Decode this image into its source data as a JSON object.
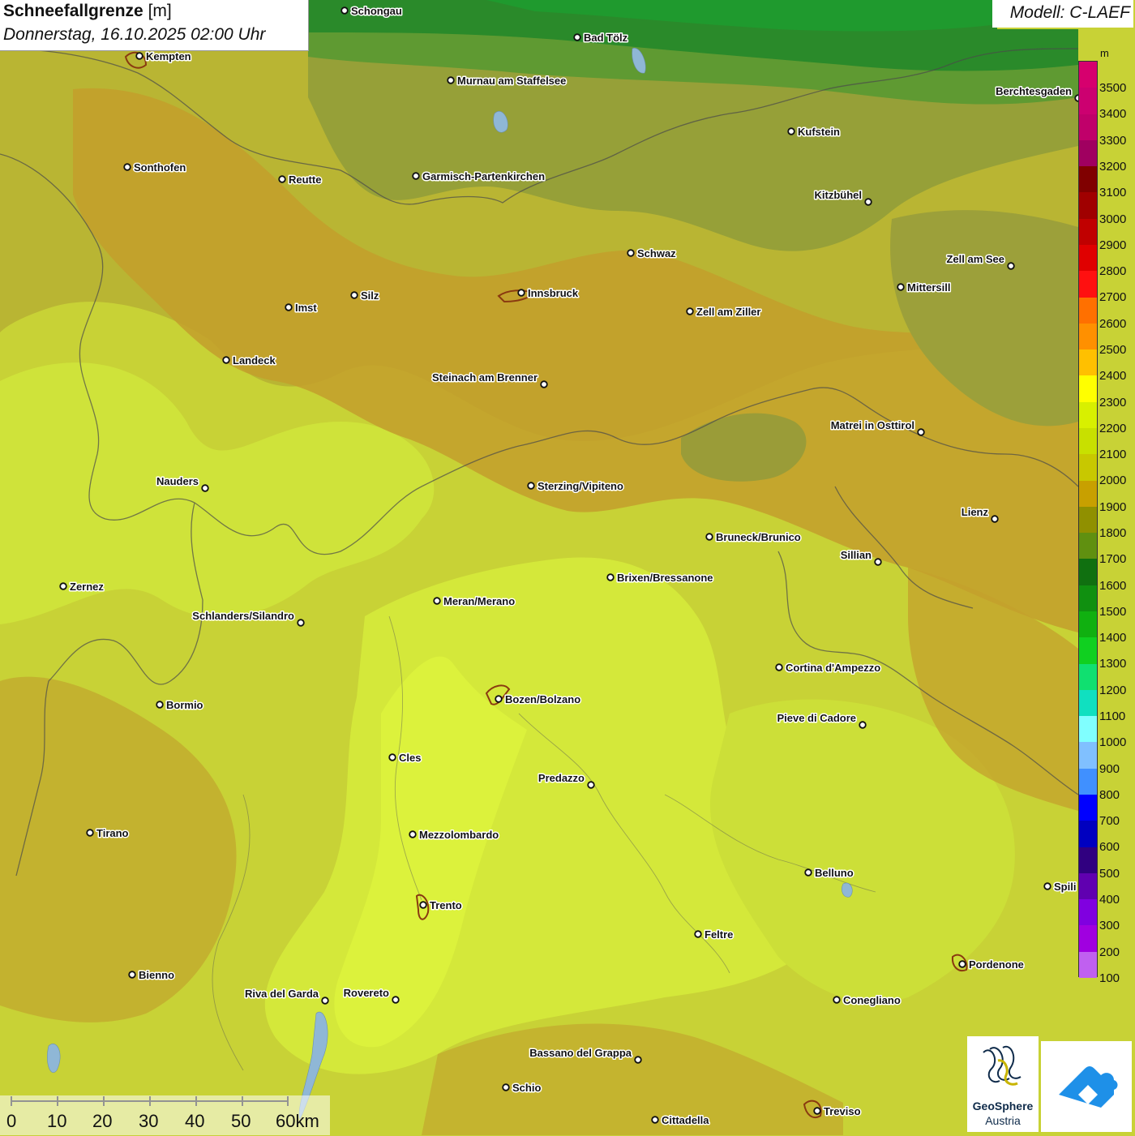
{
  "header": {
    "title": "Schneefallgrenze",
    "unit": "[m]",
    "datetime": "Donnerstag, 16.10.2025 02:00 Uhr",
    "model": "Modell: C-LAEF"
  },
  "legend": {
    "unit": "m",
    "labels": [
      "3500",
      "3400",
      "3300",
      "3200",
      "3100",
      "3000",
      "2900",
      "2800",
      "2700",
      "2600",
      "2500",
      "2400",
      "2300",
      "2200",
      "2100",
      "2000",
      "1900",
      "1800",
      "1700",
      "1600",
      "1500",
      "1400",
      "1300",
      "1200",
      "1100",
      "1000",
      "900",
      "800",
      "700",
      "600",
      "500",
      "400",
      "300",
      "200",
      "100"
    ],
    "colors": [
      "#d6006e",
      "#cc0070",
      "#c0006a",
      "#a00060",
      "#800000",
      "#a00000",
      "#c00000",
      "#e00000",
      "#ff1010",
      "#ff7000",
      "#ff9000",
      "#ffc000",
      "#ffff00",
      "#d8f000",
      "#c8e000",
      "#c8c800",
      "#c8a000",
      "#909000",
      "#609010",
      "#107010",
      "#109010",
      "#10b010",
      "#10d020",
      "#10e070",
      "#10e0c0",
      "#80ffff",
      "#80c0ff",
      "#4090ff",
      "#0000ff",
      "#0000c0",
      "#300080",
      "#6000b0",
      "#8000e0",
      "#a000e0",
      "#c060f0"
    ]
  },
  "map": {
    "cities": [
      {
        "name": "Schongau",
        "side": "right"
      },
      {
        "name": "Bad Tölz",
        "side": "right"
      },
      {
        "name": "Kempten",
        "side": "right"
      },
      {
        "name": "Murnau am Staffelsee",
        "side": "right"
      },
      {
        "name": "Berchtesgaden",
        "side": "left"
      },
      {
        "name": "Kufstein",
        "side": "right"
      },
      {
        "name": "Sonthofen",
        "side": "right"
      },
      {
        "name": "Reutte",
        "side": "right"
      },
      {
        "name": "Garmisch-Partenkirchen",
        "side": "right"
      },
      {
        "name": "Kitzbühel",
        "side": "left"
      },
      {
        "name": "Schwaz",
        "side": "right"
      },
      {
        "name": "Zell am See",
        "side": "left"
      },
      {
        "name": "Innsbruck",
        "side": "right"
      },
      {
        "name": "Mittersill",
        "side": "right"
      },
      {
        "name": "Silz",
        "side": "right"
      },
      {
        "name": "Imst",
        "side": "right"
      },
      {
        "name": "Zell am Ziller",
        "side": "right"
      },
      {
        "name": "Landeck",
        "side": "right"
      },
      {
        "name": "Steinach am Brenner",
        "side": "left"
      },
      {
        "name": "Matrei in Osttirol",
        "side": "left"
      },
      {
        "name": "Nauders",
        "side": "left"
      },
      {
        "name": "Sterzing/Vipiteno",
        "side": "right"
      },
      {
        "name": "Lienz",
        "side": "left"
      },
      {
        "name": "Bruneck/Brunico",
        "side": "right"
      },
      {
        "name": "Sillian",
        "side": "left"
      },
      {
        "name": "Zernez",
        "side": "right"
      },
      {
        "name": "Brixen/Bressanone",
        "side": "right"
      },
      {
        "name": "Meran/Merano",
        "side": "right"
      },
      {
        "name": "Schlanders/Silandro",
        "side": "left"
      },
      {
        "name": "Cortina d'Ampezzo",
        "side": "right"
      },
      {
        "name": "Bormio",
        "side": "right"
      },
      {
        "name": "Bozen/Bolzano",
        "side": "right"
      },
      {
        "name": "Pieve di Cadore",
        "side": "left"
      },
      {
        "name": "Cles",
        "side": "right"
      },
      {
        "name": "Predazzo",
        "side": "left"
      },
      {
        "name": "Tirano",
        "side": "right"
      },
      {
        "name": "Mezzolombardo",
        "side": "right"
      },
      {
        "name": "Belluno",
        "side": "right"
      },
      {
        "name": "Spili",
        "side": "right"
      },
      {
        "name": "Trento",
        "side": "right"
      },
      {
        "name": "Feltre",
        "side": "right"
      },
      {
        "name": "Pordenone",
        "side": "right"
      },
      {
        "name": "Bienno",
        "side": "right"
      },
      {
        "name": "Riva del Garda",
        "side": "left"
      },
      {
        "name": "Rovereto",
        "side": "left"
      },
      {
        "name": "Conegliano",
        "side": "right"
      },
      {
        "name": "Bassano del Grappa",
        "side": "left"
      },
      {
        "name": "Schio",
        "side": "right"
      },
      {
        "name": "Treviso",
        "side": "right"
      },
      {
        "name": "Cittadella",
        "side": "right"
      }
    ]
  },
  "scale": {
    "labels": [
      "0",
      "10",
      "20",
      "30",
      "40",
      "50",
      "60km"
    ]
  },
  "logos": {
    "geosphere_line1": "GeoSphere",
    "geosphere_line2": "Austria"
  }
}
